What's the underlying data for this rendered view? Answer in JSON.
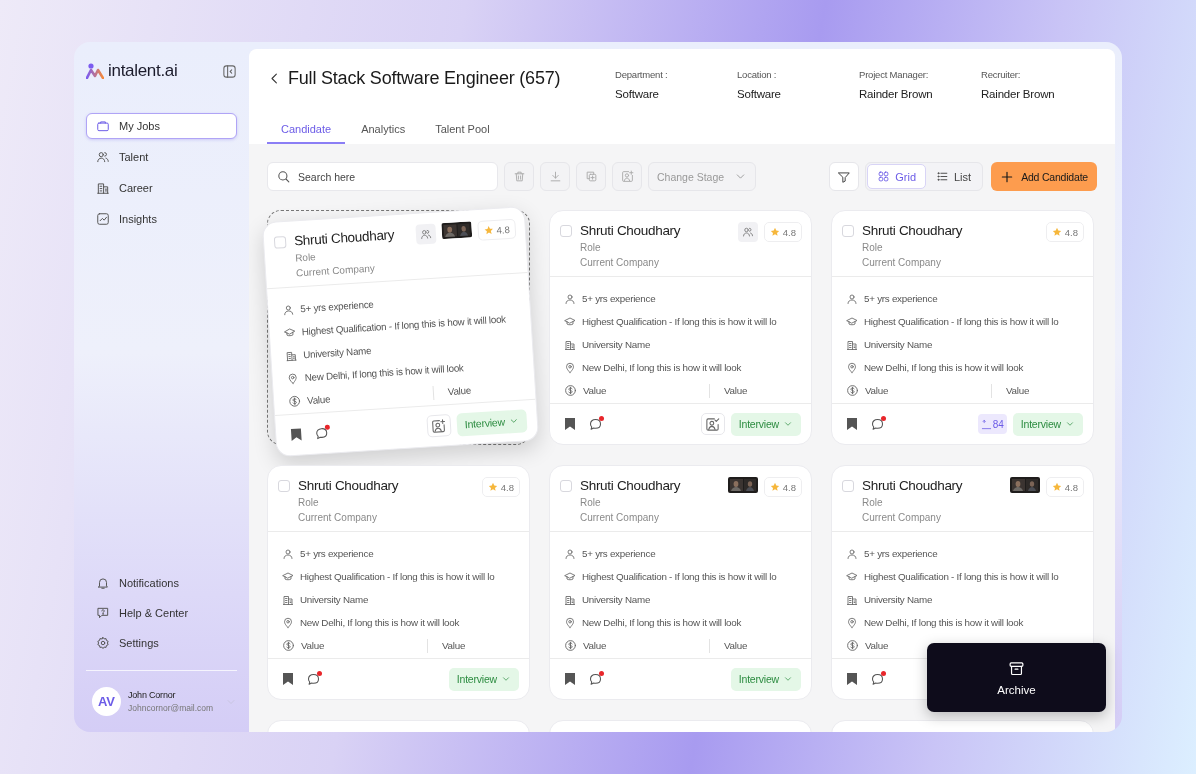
{
  "sidebar": {
    "logo": "intalent.ai",
    "nav": [
      {
        "kind": "jobs",
        "label": "My Jobs",
        "selected": true
      },
      {
        "kind": "talent",
        "label": "Talent",
        "selected": false
      },
      {
        "kind": "career",
        "label": "Career",
        "selected": false
      },
      {
        "kind": "insights",
        "label": "Insights",
        "selected": false
      }
    ],
    "bottom_nav": [
      {
        "kind": "notifications",
        "label": "Notifications"
      },
      {
        "kind": "help",
        "label": "Help & Center"
      },
      {
        "kind": "settings",
        "label": "Settings"
      }
    ],
    "user": {
      "initials": "AV",
      "name": "John Cornor",
      "email": "Johncornor@mail.com"
    }
  },
  "header": {
    "title": "Full Stack Software Engineer (657)",
    "meta": [
      {
        "label": "Department :",
        "value": "Software"
      },
      {
        "label": "Location :",
        "value": "Software"
      },
      {
        "label": "Project Manager:",
        "value": "Rainder Brown"
      },
      {
        "label": "Recruiter:",
        "value": "Rainder Brown"
      }
    ],
    "tabs": [
      {
        "label": "Candidate",
        "selected": true
      },
      {
        "label": "Analytics",
        "selected": false
      },
      {
        "label": "Talent Pool",
        "selected": false
      }
    ]
  },
  "toolbar": {
    "search": {
      "placeholder": "Search here"
    },
    "actions": [
      {
        "kind": "delete"
      },
      {
        "kind": "download"
      },
      {
        "kind": "copy"
      },
      {
        "kind": "add-photo"
      }
    ],
    "stage": {
      "label": "Change Stage",
      "disabled": true
    },
    "views": [
      {
        "kind": "grid",
        "label": "Grid",
        "selected": true
      },
      {
        "kind": "list",
        "label": "List",
        "selected": false
      }
    ],
    "add_button": "Add Candidate"
  },
  "cards": [
    {
      "kind": "full",
      "dragging": true,
      "checked": false,
      "name": "Shruti Choudhary",
      "role": "Role",
      "company": "Current Company",
      "badges": [
        {
          "kind": "invite"
        },
        {
          "kind": "video"
        }
      ],
      "rating": "4.8",
      "experience": "5+ yrs experience",
      "qualification": "Highest Qualification - If long this is how it will look",
      "university": "University Name",
      "location": "New Delhi, If long this is how it will look",
      "values": [
        "Value",
        "Value"
      ],
      "action": {
        "kind": "add-photo"
      },
      "stage": "Interview"
    },
    {
      "kind": "full",
      "dragging": false,
      "checked": false,
      "name": "Shruti Choudhary",
      "role": "Role",
      "company": "Current Company",
      "badges": [
        {
          "kind": "invite"
        }
      ],
      "rating": "4.8",
      "experience": "5+ yrs experience",
      "qualification": "Highest Qualification - If long this is how it will lo",
      "university": "University Name",
      "location": "New Delhi, If long this is how it will look",
      "values": [
        "Value",
        "Value"
      ],
      "action": {
        "kind": "verified-photo"
      },
      "stage": "Interview"
    },
    {
      "kind": "full",
      "dragging": false,
      "checked": false,
      "name": "Shruti Choudhary",
      "role": "Role",
      "company": "Current Company",
      "rating": "4.8",
      "experience": "5+ yrs experience",
      "qualification": "Highest Qualification - If long this is how it will lo",
      "university": "University Name",
      "location": "New Delhi, If long this is how it will look",
      "values": [
        "Value",
        "Value"
      ],
      "action": {
        "kind": "count",
        "text": "84"
      },
      "stage": "Interview"
    },
    {
      "kind": "full",
      "dragging": false,
      "checked": false,
      "name": "Shruti Choudhary",
      "role": "Role",
      "company": "Current Company",
      "rating": "4.8",
      "experience": "5+ yrs experience",
      "qualification": "Highest Qualification - If long this is how it will lo",
      "university": "University Name",
      "location": "New Delhi, If long this is how it will look",
      "values": [
        "Value",
        "Value"
      ],
      "stage": "Interview"
    },
    {
      "kind": "full",
      "dragging": false,
      "checked": false,
      "name": "Shruti Choudhary",
      "role": "Role",
      "company": "Current Company",
      "badges": [
        {
          "kind": "video"
        }
      ],
      "rating": "4.8",
      "experience": "5+ yrs experience",
      "qualification": "Highest Qualification - If long this is how it will lo",
      "university": "University Name",
      "location": "New Delhi, If long this is how it will look",
      "values": [
        "Value",
        "Value"
      ],
      "stage": "Interview"
    },
    {
      "kind": "full",
      "dragging": false,
      "checked": false,
      "name": "Shruti Choudhary",
      "role": "Role",
      "company": "Current Company",
      "badges": [
        {
          "kind": "video"
        }
      ],
      "rating": "4.8",
      "experience": "5+ yrs experience",
      "qualification": "Highest Qualification - If long this is how it will lo",
      "university": "University Name",
      "location": "New Delhi, If long this is how it will look",
      "values": [
        "Value"
      ]
    },
    {
      "kind": "clipped"
    },
    {
      "kind": "clipped"
    },
    {
      "kind": "clipped"
    }
  ],
  "archive_popup": {
    "label": "Archive"
  }
}
